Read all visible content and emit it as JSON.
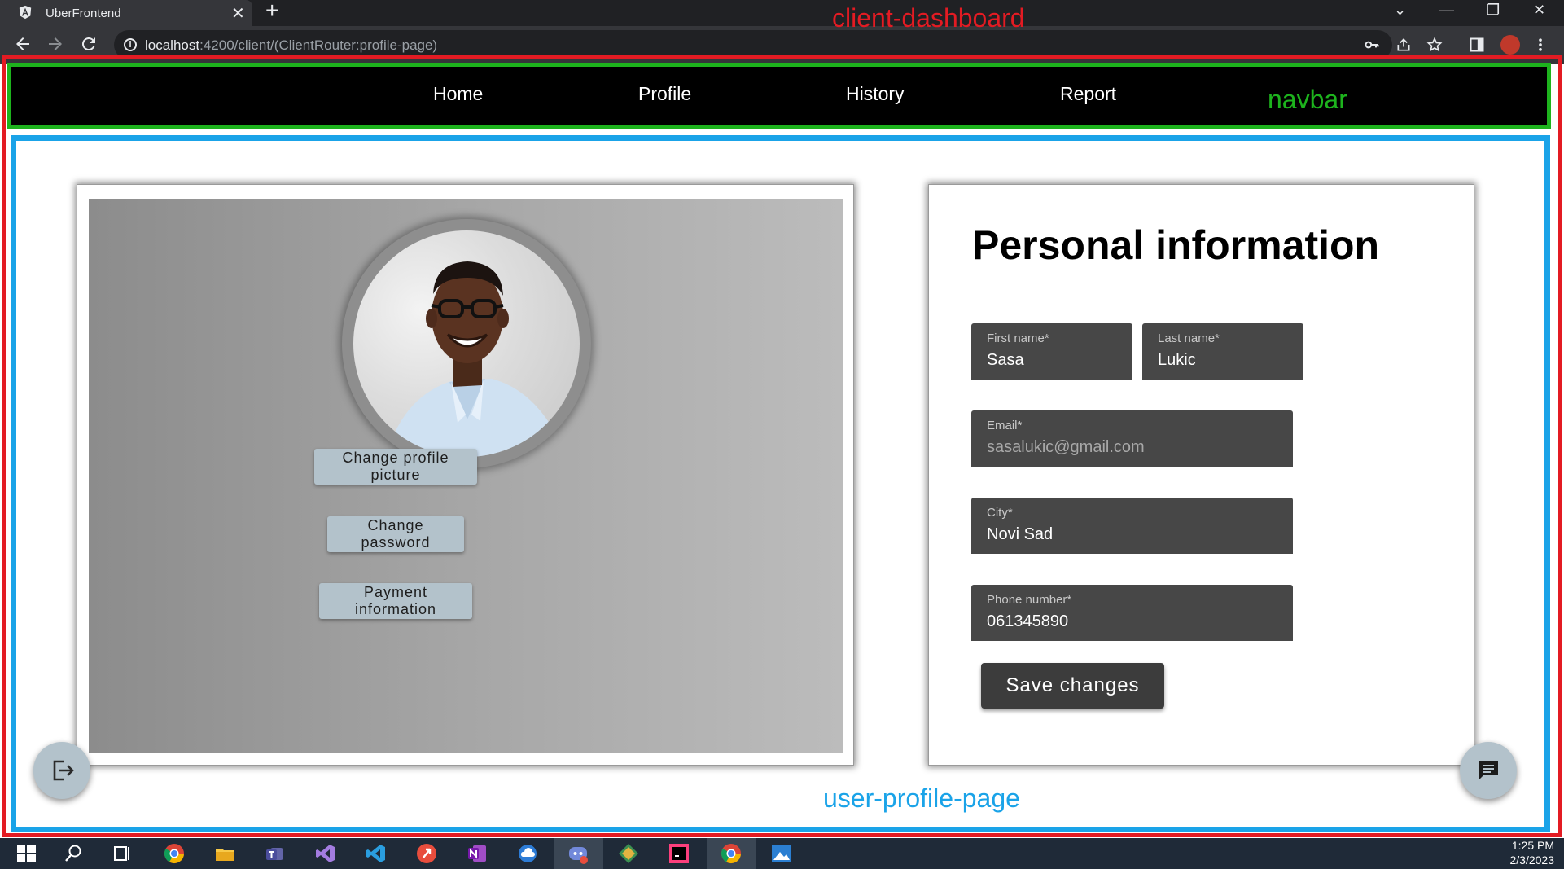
{
  "browser": {
    "tab_title": "UberFrontend",
    "tab_close": "✕",
    "new_tab": "+",
    "url_host": "localhost",
    "url_path": ":4200/client/(ClientRouter:profile-page)",
    "window_controls": [
      "⌄",
      "—",
      "❐",
      "✕"
    ]
  },
  "annotations": {
    "client_dashboard": "client-dashboard",
    "navbar": "navbar",
    "user_profile_page": "user-profile-page",
    "colors": {
      "client_dashboard": "#e31b23",
      "navbar": "#1db31d",
      "user_profile_page": "#1aa3e8"
    }
  },
  "navbar": {
    "items": [
      {
        "label": "Home"
      },
      {
        "label": "Profile"
      },
      {
        "label": "History"
      },
      {
        "label": "Report"
      }
    ]
  },
  "profile_card": {
    "avatar_alt": "profile picture",
    "buttons": {
      "change_picture": "Change profile picture",
      "change_password": "Change password",
      "payment_info": "Payment information"
    }
  },
  "personal_info": {
    "title": "Personal information",
    "fields": {
      "first_name": {
        "label": "First name*",
        "value": "Sasa"
      },
      "last_name": {
        "label": "Last name*",
        "value": "Lukic"
      },
      "email": {
        "label": "Email*",
        "value": "sasalukic@gmail.com",
        "disabled": true
      },
      "city": {
        "label": "City*",
        "value": "Novi Sad"
      },
      "phone": {
        "label": "Phone number*",
        "value": "061345890"
      }
    },
    "save_label": "Save changes"
  },
  "fabs": {
    "logout_icon": "logout-icon",
    "chat_icon": "chat-icon"
  },
  "taskbar": {
    "time": "1:25 PM",
    "date": "2/3/2023",
    "apps": [
      "windows-start",
      "search",
      "task-view",
      "chrome",
      "file-explorer",
      "teams",
      "visual-studio",
      "vscode",
      "git",
      "onenote",
      "cloud",
      "discord",
      "sourcetree",
      "intellij",
      "chrome-active",
      "photos"
    ]
  }
}
